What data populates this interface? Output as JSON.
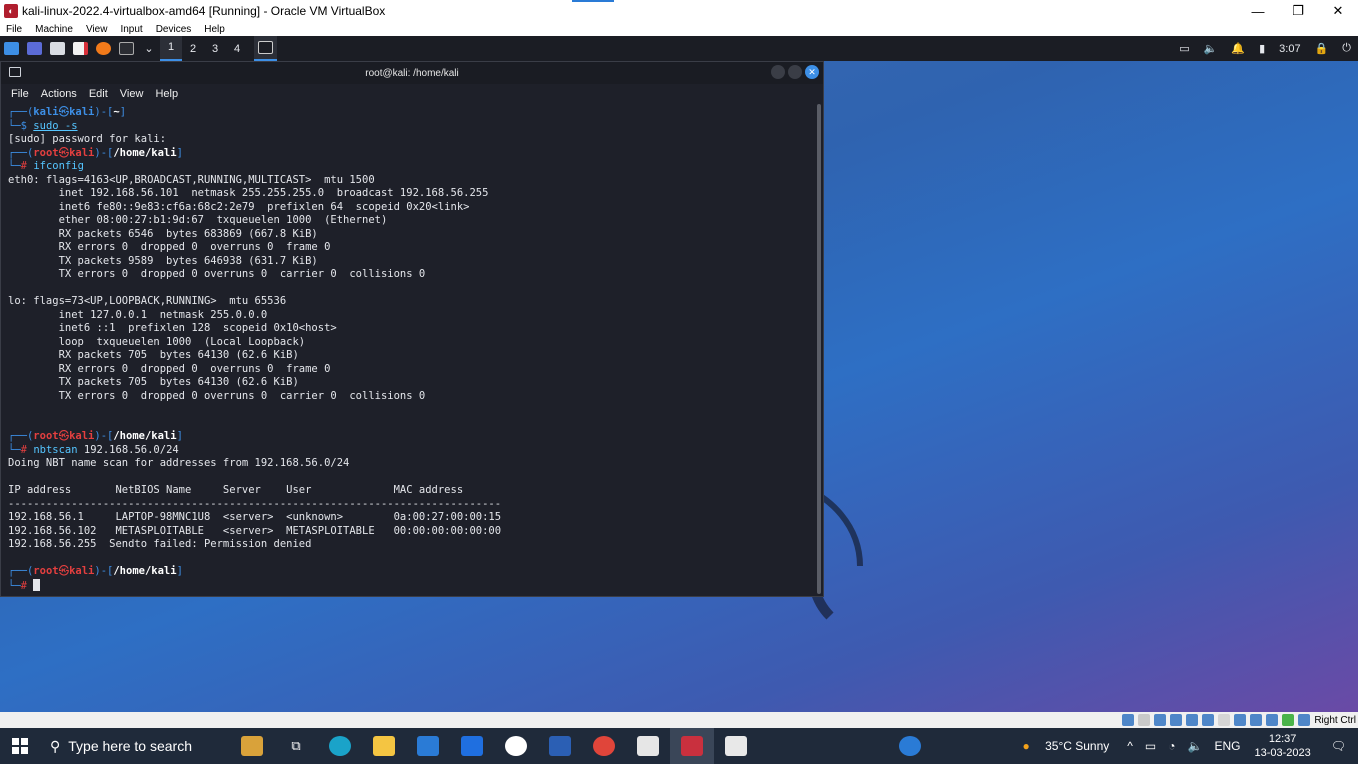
{
  "host_window": {
    "title": "kali-linux-2022.4-virtualbox-amd64 [Running] - Oracle VM VirtualBox",
    "menu": [
      "File",
      "Machine",
      "View",
      "Input",
      "Devices",
      "Help"
    ],
    "controls": {
      "minimize": "—",
      "maximize": "❐",
      "close": "✕"
    }
  },
  "kali_panel": {
    "workspaces": [
      "1",
      "2",
      "3",
      "4"
    ],
    "active_workspace": "1",
    "time": "3:07"
  },
  "terminal": {
    "title": "root@kali: /home/kali",
    "menu": [
      "File",
      "Actions",
      "Edit",
      "View",
      "Help"
    ],
    "prompt1_user": "kali",
    "prompt1_dir": "~",
    "cmd1": "sudo -s",
    "out_sudo": "[sudo] password for kali:",
    "prompt_root": "root",
    "prompt_host": "kali",
    "prompt_dir": "/home/kali",
    "cmd2": "ifconfig",
    "ifconfig": [
      "eth0: flags=4163<UP,BROADCAST,RUNNING,MULTICAST>  mtu 1500",
      "        inet 192.168.56.101  netmask 255.255.255.0  broadcast 192.168.56.255",
      "        inet6 fe80::9e83:cf6a:68c2:2e79  prefixlen 64  scopeid 0x20<link>",
      "        ether 08:00:27:b1:9d:67  txqueuelen 1000  (Ethernet)",
      "        RX packets 6546  bytes 683869 (667.8 KiB)",
      "        RX errors 0  dropped 0  overruns 0  frame 0",
      "        TX packets 9589  bytes 646938 (631.7 KiB)",
      "        TX errors 0  dropped 0 overruns 0  carrier 0  collisions 0",
      "",
      "lo: flags=73<UP,LOOPBACK,RUNNING>  mtu 65536",
      "        inet 127.0.0.1  netmask 255.0.0.0",
      "        inet6 ::1  prefixlen 128  scopeid 0x10<host>",
      "        loop  txqueuelen 1000  (Local Loopback)",
      "        RX packets 705  bytes 64130 (62.6 KiB)",
      "        RX errors 0  dropped 0  overruns 0  frame 0",
      "        TX packets 705  bytes 64130 (62.6 KiB)",
      "        TX errors 0  dropped 0 overruns 0  carrier 0  collisions 0"
    ],
    "cmd3_name": "nbtscan",
    "cmd3_arg": " 192.168.56.0/24",
    "nbtscan": [
      "Doing NBT name scan for addresses from 192.168.56.0/24",
      "",
      "IP address       NetBIOS Name     Server    User             MAC address",
      "------------------------------------------------------------------------------",
      "192.168.56.1     LAPTOP-98MNC1U8  <server>  <unknown>        0a:00:27:00:00:15",
      "192.168.56.102   METASPLOITABLE   <server>  METASPLOITABLE   00:00:00:00:00:00",
      "192.168.56.255  Sendto failed: Permission denied"
    ]
  },
  "vbox_status": {
    "host_key": "Right Ctrl"
  },
  "taskbar": {
    "search_placeholder": "Type here to search",
    "weather": "35°C  Sunny",
    "language": "ENG",
    "time": "12:37",
    "date": "13-03-2023"
  },
  "colors": {
    "kali_blue": "#3d8fe6",
    "kali_red": "#e43f3f",
    "terminal_bg": "#1e2029"
  }
}
